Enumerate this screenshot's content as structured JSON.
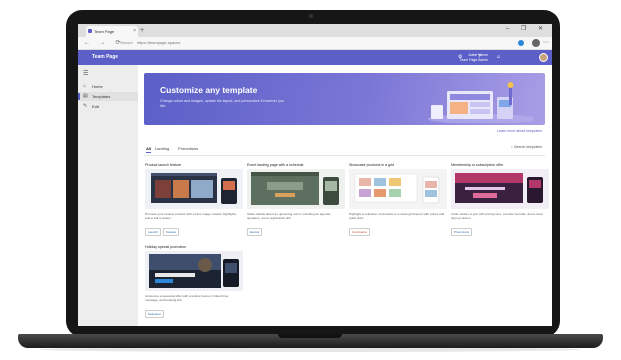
{
  "browser": {
    "tab_title": "Team Page",
    "url": "https://teampage.spaces",
    "url_security": "Secure",
    "new_tab": "+",
    "window_controls": "– ❐ ✕",
    "nav": "← → ⟳"
  },
  "app": {
    "title": "Team Page",
    "user_line1": "Adele Vance",
    "user_line2": "Team Page Admin",
    "header_icons": "⚙ ? ☺"
  },
  "sidebar": {
    "items": [
      {
        "icon": "⌂",
        "label": "Home"
      },
      {
        "icon": "▤",
        "label": "Templates"
      },
      {
        "icon": "✎",
        "label": "Edit"
      }
    ]
  },
  "hero": {
    "title": "Customize any template",
    "description": "Change colors and images, update the layout, and personalize it however you like.",
    "link": "Learn more about templates"
  },
  "filters": [
    "All",
    "Landing",
    "Promotions"
  ],
  "search_label": "Search templates",
  "cards": [
    {
      "title": "Product launch feature",
      "description": "Promote your newest product with a hero image, feature highlights, and a call to action.",
      "tags": [
        "Launch",
        "Feature"
      ]
    },
    {
      "title": "Event landing page with a schedule",
      "description": "Share details about an upcoming event, including an agenda, speakers, and a registration link.",
      "tags": [
        "Events"
      ]
    },
    {
      "title": "Showcase products in a grid",
      "description": "Highlight a collection of products in a clean grid layout with prices and quick links.",
      "tags": [
        "Commerce"
      ]
    },
    {
      "title": "Membership or subscription offer",
      "description": "Invite visitors to join with pricing tiers, member benefits, and a clear sign up button.",
      "tags": [
        "Promotions"
      ]
    },
    {
      "title": "Holiday special promotion",
      "description": "Announce a seasonal offer with a festive banner, limited time message, and booking link.",
      "tags": [
        "Seasonal"
      ]
    }
  ],
  "colors": {
    "accent": "#5b5fc7",
    "laptop_frame": "#161616"
  }
}
